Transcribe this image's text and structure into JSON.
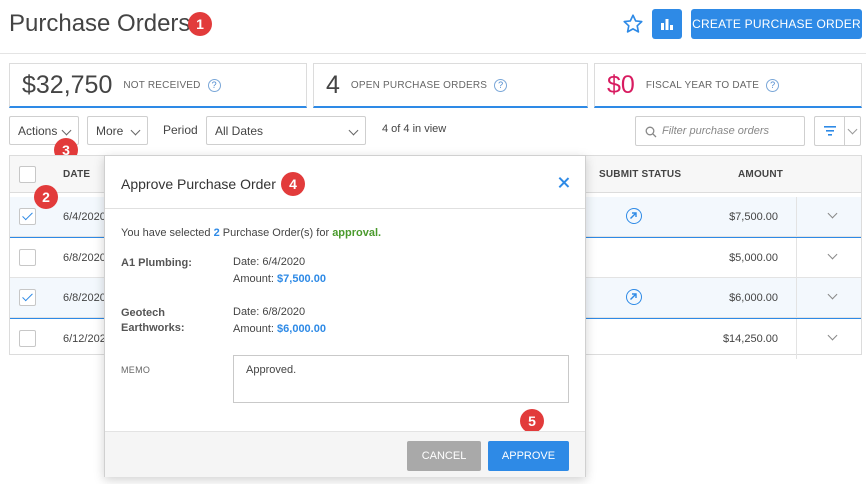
{
  "page": {
    "title": "Purchase Orders",
    "create_button": "CREATE PURCHASE ORDER"
  },
  "stats": [
    {
      "value": "$32,750",
      "label": "NOT RECEIVED",
      "help": "?",
      "color": "#444444"
    },
    {
      "value": "4",
      "label": "OPEN PURCHASE ORDERS",
      "help": "?",
      "color": "#444444"
    },
    {
      "value": "$0",
      "label": "FISCAL YEAR TO DATE",
      "help": "?",
      "color": "#d81b60"
    }
  ],
  "toolbar": {
    "actions": "Actions",
    "more": "More",
    "period_label": "Period",
    "period_value": "All Dates",
    "count": "4 of 4 in view",
    "filter_placeholder": "Filter purchase orders"
  },
  "table": {
    "headers": {
      "date": "DATE",
      "submit_status": "SUBMIT STATUS",
      "amount": "AMOUNT"
    },
    "rows": [
      {
        "date": "6/4/2020",
        "amount": "$7,500.00",
        "checked": true,
        "status_icon": "arrow-circle-icon"
      },
      {
        "date": "6/8/2020",
        "amount": "$5,000.00",
        "checked": false,
        "status_icon": ""
      },
      {
        "date": "6/8/2020",
        "amount": "$6,000.00",
        "checked": true,
        "status_icon": "arrow-circle-icon"
      },
      {
        "date": "6/12/2020",
        "amount": "$14,250.00",
        "checked": false,
        "status_icon": ""
      }
    ]
  },
  "modal": {
    "title": "Approve Purchase Order",
    "msg_prefix": "You have selected",
    "msg_count": "2",
    "msg_middle": "Purchase Order(s) for",
    "msg_action": "approval.",
    "items": [
      {
        "vendor": "A1 Plumbing:",
        "date": "Date: 6/4/2020",
        "amount_label": "Amount:",
        "amount": "$7,500.00"
      },
      {
        "vendor": "Geotech Earthworks:",
        "date": "Date: 6/8/2020",
        "amount_label": "Amount:",
        "amount": "$6,000.00"
      }
    ],
    "memo_label": "MEMO",
    "memo_value": "Approved.",
    "cancel": "CANCEL",
    "approve": "APPROVE"
  },
  "annotations": [
    "1",
    "2",
    "3",
    "4",
    "5"
  ],
  "colors": {
    "accent": "#2e8ae6",
    "badge": "#e23b3b",
    "green": "#4a9a2c"
  }
}
